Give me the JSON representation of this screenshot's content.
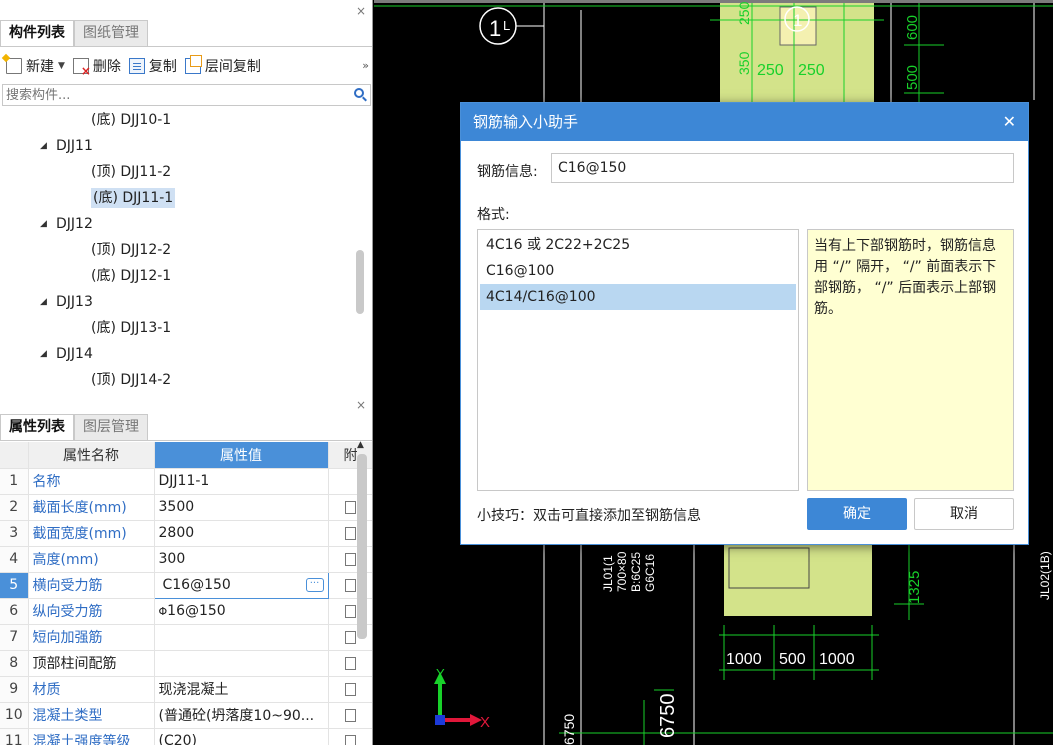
{
  "component_pane": {
    "tabs": [
      "构件列表",
      "图纸管理"
    ],
    "toolbar": {
      "new_label": "新建",
      "delete_label": "删除",
      "copy_label": "复制",
      "floor_copy_label": "层间复制"
    },
    "search_placeholder": "搜索构件...",
    "tree": [
      {
        "level": 1,
        "label": "(底) DJJ10-1"
      },
      {
        "level": 0,
        "label": "DJJ11"
      },
      {
        "level": 1,
        "label": "(顶) DJJ11-2"
      },
      {
        "level": 1,
        "label": "(底) DJJ11-1",
        "selected": true
      },
      {
        "level": 0,
        "label": "DJJ12"
      },
      {
        "level": 1,
        "label": "(顶) DJJ12-2"
      },
      {
        "level": 1,
        "label": "(底) DJJ12-1"
      },
      {
        "level": 0,
        "label": "DJJ13"
      },
      {
        "level": 1,
        "label": "(底) DJJ13-1"
      },
      {
        "level": 0,
        "label": "DJJ14"
      },
      {
        "level": 1,
        "label": "(顶) DJJ14-2"
      }
    ]
  },
  "property_pane": {
    "tabs": [
      "属性列表",
      "图层管理"
    ],
    "columns": {
      "name": "属性名称",
      "value": "属性值",
      "extra": "附"
    },
    "rows": [
      {
        "num": "1",
        "name": "名称",
        "value": "DJJ11-1"
      },
      {
        "num": "2",
        "name": "截面长度(mm)",
        "value": "3500"
      },
      {
        "num": "3",
        "name": "截面宽度(mm)",
        "value": "2800"
      },
      {
        "num": "4",
        "name": "高度(mm)",
        "value": "300"
      },
      {
        "num": "5",
        "name": "横向受力筋",
        "value": "C16@150"
      },
      {
        "num": "6",
        "name": "纵向受力筋",
        "value": "16@150"
      },
      {
        "num": "7",
        "name": "短向加强筋",
        "value": ""
      },
      {
        "num": "8",
        "name": "顶部柱间配筋",
        "value": ""
      },
      {
        "num": "9",
        "name": "材质",
        "value": "现浇混凝土"
      },
      {
        "num": "10",
        "name": "混凝土类型",
        "value": "(普通砼(坍落度10~90..."
      },
      {
        "num": "11",
        "name": "混凝土强度等级",
        "value": "(C20)"
      }
    ],
    "active_row": "5",
    "phi_symbol": "Φ"
  },
  "canvas": {
    "labels": [
      "250",
      "250",
      "250",
      "350",
      "600",
      "500",
      "JL01(1",
      "700×80",
      "B:6C25",
      "G6C16",
      "1325",
      "1000",
      "500",
      "1000",
      "6750",
      "6750",
      "JL02(1B)",
      "1",
      "Y",
      "X"
    ]
  },
  "dialog": {
    "title": "钢筋输入小助手",
    "info_label": "钢筋信息:",
    "info_value": "C16@150",
    "format_label": "格式:",
    "formats": [
      "4C16 或 2C22+2C25",
      "C16@100",
      "4C14/C16@100"
    ],
    "selected_format": "4C14/C16@100",
    "note": "当有上下部钢筋时，钢筋信息用 “/” 隔开， “/” 前面表示下部钢筋， “/” 后面表示上部钢筋。",
    "tip": "小技巧：双击可直接添加至钢筋信息",
    "ok_label": "确定",
    "cancel_label": "取消"
  }
}
